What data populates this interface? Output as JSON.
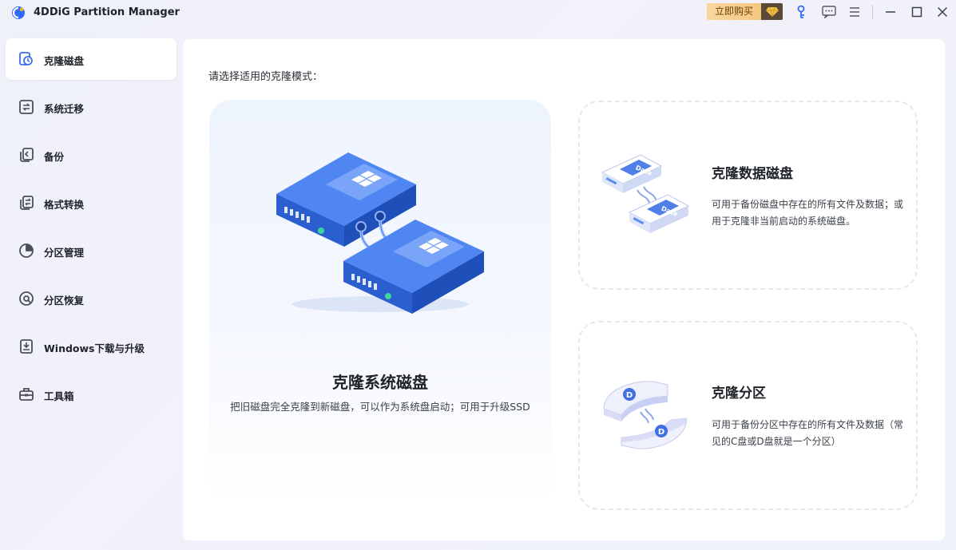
{
  "app": {
    "title": "4DDiG Partition Manager"
  },
  "titlebar": {
    "buy_label": "立即购买",
    "icons": [
      "diamond-icon",
      "key-icon",
      "feedback-icon",
      "menu-icon",
      "minimize-icon",
      "maximize-icon",
      "close-icon"
    ]
  },
  "sidebar": {
    "items": [
      {
        "label": "克隆磁盘",
        "icon": "clone-disk-icon",
        "active": true
      },
      {
        "label": "系统迁移",
        "icon": "system-migrate-icon",
        "active": false
      },
      {
        "label": "备份",
        "icon": "backup-icon",
        "active": false
      },
      {
        "label": "格式转换",
        "icon": "format-convert-icon",
        "active": false
      },
      {
        "label": "分区管理",
        "icon": "partition-manage-icon",
        "active": false
      },
      {
        "label": "分区恢复",
        "icon": "partition-recover-icon",
        "active": false
      },
      {
        "label": "Windows下载与升级",
        "icon": "windows-download-icon",
        "active": false
      },
      {
        "label": "工具箱",
        "icon": "toolbox-icon",
        "active": false
      }
    ]
  },
  "main": {
    "prompt": "请选择适用的克隆模式：",
    "cards": [
      {
        "title": "克隆系统磁盘",
        "desc": "把旧磁盘完全克隆到新磁盘，可以作为系统盘启动；可用于升级SSD"
      },
      {
        "title": "克隆数据磁盘",
        "desc": "可用于备份磁盘中存在的所有文件及数据；或用于克隆非当前启动的系统磁盘。",
        "art_text": "Data"
      },
      {
        "title": "克隆分区",
        "desc": "可用于备份分区中存在的所有文件及数据（常见的C盘或D盘就是一个分区）",
        "art_text": "D"
      }
    ]
  },
  "colors": {
    "accent": "#3b6fe6",
    "buy": "#f6cf8c",
    "text": "#1f2329"
  }
}
